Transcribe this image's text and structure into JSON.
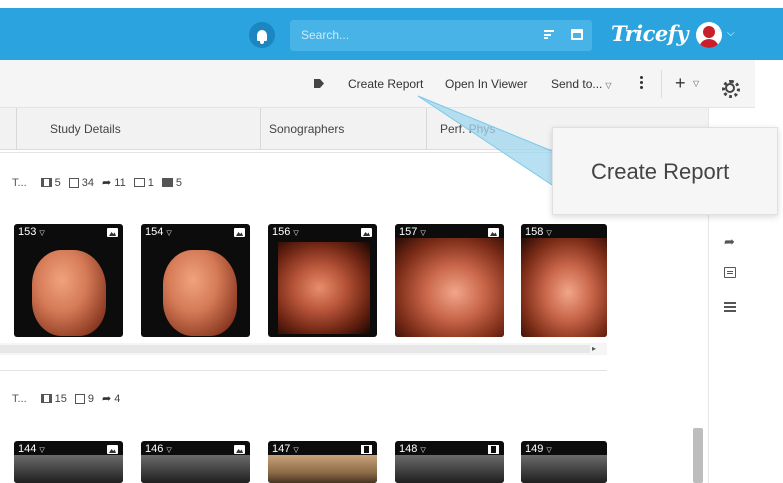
{
  "header": {
    "search_placeholder": "Search...",
    "logo_text": "Tricefy",
    "accent_color": "#2aa3de"
  },
  "toolbar": {
    "create_report": "Create Report",
    "open_in_viewer": "Open In Viewer",
    "send_to": "Send to..."
  },
  "table_header": {
    "study_details": "Study Details",
    "sonographers": "Sonographers",
    "perf_phys": "Perf. Phys"
  },
  "callout": {
    "text": "Create Report"
  },
  "studies": [
    {
      "truncated": "T...",
      "stats": {
        "videos": "5",
        "images": "34",
        "shared": "11",
        "comments": "1",
        "kits": "5"
      },
      "thumbnails": [
        {
          "label": "153",
          "type": "image"
        },
        {
          "label": "154",
          "type": "image"
        },
        {
          "label": "156",
          "type": "image"
        },
        {
          "label": "157",
          "type": "image"
        },
        {
          "label": "158",
          "type": "image"
        }
      ]
    },
    {
      "truncated": "T...",
      "stats": {
        "videos": "15",
        "images": "9",
        "shared": "4"
      },
      "thumbnails": [
        {
          "label": "144",
          "type": "image"
        },
        {
          "label": "146",
          "type": "image"
        },
        {
          "label": "147",
          "type": "video"
        },
        {
          "label": "148",
          "type": "video"
        },
        {
          "label": "149",
          "type": "image"
        }
      ]
    }
  ]
}
